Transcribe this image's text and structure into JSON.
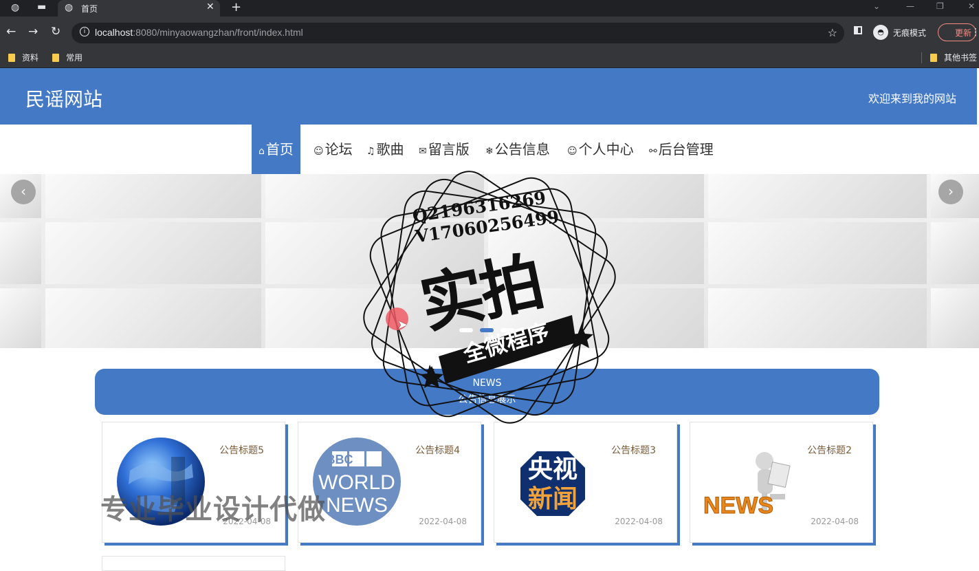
{
  "browser": {
    "tab_title": "首页",
    "url_host": "localhost",
    "url_rest": ":8080/minyaowangzhan/front/index.html",
    "incognito_label": "无痕模式",
    "update_label": "更新",
    "bookmarks": [
      "资料",
      "常用"
    ],
    "other_bookmarks": "其他书签"
  },
  "site": {
    "title": "民谣网站",
    "welcome": "欢迎来到我的网站"
  },
  "nav": [
    {
      "icon": "⌂",
      "label": "首页"
    },
    {
      "icon": "☺",
      "label": "论坛"
    },
    {
      "icon": "♫",
      "label": "歌曲"
    },
    {
      "icon": "✉",
      "label": "留言版"
    },
    {
      "icon": "❄",
      "label": "公告信息"
    },
    {
      "icon": "☺",
      "label": "个人中心"
    },
    {
      "icon": "⚯",
      "label": "后台管理"
    }
  ],
  "news_section": {
    "en": "NEWS",
    "cn": "公告信息展示"
  },
  "cards": [
    {
      "title": "公告标题5",
      "date": "2022-04-08",
      "image": "globe"
    },
    {
      "title": "公告标题4",
      "date": "2022-04-08",
      "image": "bbc-world-news"
    },
    {
      "title": "公告标题3",
      "date": "2022-04-08",
      "image": "cctv-news"
    },
    {
      "title": "公告标题2",
      "date": "2022-04-08",
      "image": "news-figure"
    }
  ],
  "cctv_logo": {
    "line1": "央视",
    "line2": "新闻"
  },
  "bbc_logo": {
    "line1": "BBC",
    "line2": "WORLD",
    "line3": "NEWS"
  },
  "news_figure_text": "NEWS",
  "overlay": {
    "qq": "Q2196316269",
    "vx": "V17060256499",
    "big": "实拍",
    "ribbon": "全微程序",
    "watermark": "专业毕业设计代做"
  },
  "colors": {
    "brand": "#4479c6"
  }
}
